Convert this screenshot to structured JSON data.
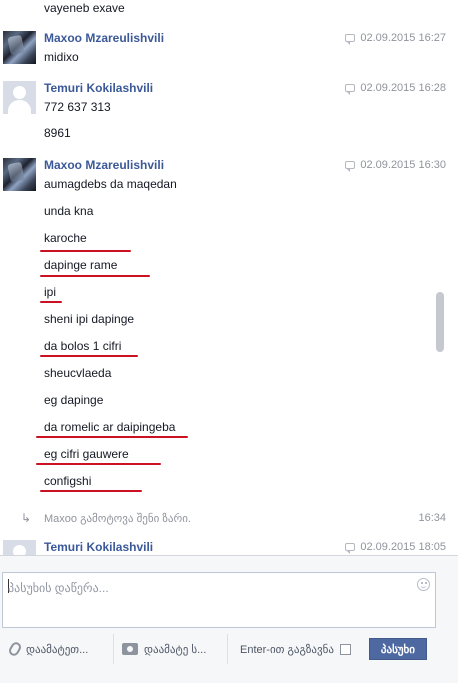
{
  "thread": {
    "top_partial_message": "vayeneb exave",
    "groups": [
      {
        "sender": "Maxoo Mzareulishvili",
        "timestamp": "02.09.2015 16:27",
        "avatar": "user-photo",
        "lines": [
          "midixo"
        ]
      },
      {
        "sender": "Temuri Kokilashvili",
        "timestamp": "02.09.2015 16:28",
        "avatar": "default-avatar",
        "lines": [
          "772 637 313",
          "8961"
        ]
      },
      {
        "sender": "Maxoo Mzareulishvili",
        "timestamp": "02.09.2015 16:30",
        "avatar": "user-photo",
        "lines": [
          "aumagdebs da maqedan",
          "unda kna",
          "karoche",
          "dapinge rame",
          "ipi",
          "sheni ipi dapinge",
          "da bolos 1 cifri",
          "sheucvlaeda",
          "eg dapinge",
          "da romelic ar daipingeba",
          "eg cifri gauwere",
          "configshi"
        ]
      },
      {
        "sender": "Temuri Kokilashvili",
        "timestamp": "02.09.2015 18:05",
        "avatar": "default-avatar",
        "lines": []
      }
    ],
    "system_event": {
      "text": "Maxoo გამოტოვა შენი ზარი.",
      "time": "16:34",
      "icon": "missed-call-icon"
    },
    "annotation_color": "#cc1122"
  },
  "composer": {
    "placeholder": "პასუხის დაწერა...",
    "attach_file_label": "დაამატეთ...",
    "attach_photo_label": "დაამატე ს...",
    "enter_to_send_label": "Enter-ით გაგზავნა",
    "reply_button_label": "პასუხი"
  },
  "colors": {
    "sender_name": "#3b5998",
    "reply_button": "#4e69a2"
  }
}
